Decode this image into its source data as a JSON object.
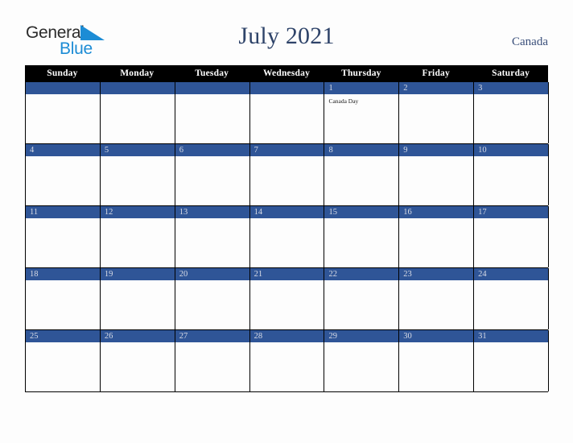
{
  "page": {
    "background_color": "#fdfdfd"
  },
  "brand": {
    "name_part1": "General",
    "name_part2": "Blue",
    "triangle_icon": "blue-triangle-logo-mark",
    "color_dark": "#2b2b2b",
    "color_blue": "#1c8cd5"
  },
  "header": {
    "title": "July 2021",
    "country": "Canada",
    "title_color": "#2e4369",
    "country_color": "#3a4f7a"
  },
  "calendar": {
    "month": "July",
    "year": "2021",
    "locale": "Canada",
    "header_bg": "#000000",
    "date_band_color": "#2f5597",
    "date_text_color": "#d9dce6",
    "cell_bg": "#fdfdfd",
    "day_names": [
      "Sunday",
      "Monday",
      "Tuesday",
      "Wednesday",
      "Thursday",
      "Friday",
      "Saturday"
    ],
    "weeks": [
      [
        {
          "date": "",
          "blank": true,
          "events": []
        },
        {
          "date": "",
          "blank": true,
          "events": []
        },
        {
          "date": "",
          "blank": true,
          "events": []
        },
        {
          "date": "",
          "blank": true,
          "events": []
        },
        {
          "date": "1",
          "blank": false,
          "events": [
            "Canada Day"
          ]
        },
        {
          "date": "2",
          "blank": false,
          "events": []
        },
        {
          "date": "3",
          "blank": false,
          "events": []
        }
      ],
      [
        {
          "date": "4",
          "blank": false,
          "events": []
        },
        {
          "date": "5",
          "blank": false,
          "events": []
        },
        {
          "date": "6",
          "blank": false,
          "events": []
        },
        {
          "date": "7",
          "blank": false,
          "events": []
        },
        {
          "date": "8",
          "blank": false,
          "events": []
        },
        {
          "date": "9",
          "blank": false,
          "events": []
        },
        {
          "date": "10",
          "blank": false,
          "events": []
        }
      ],
      [
        {
          "date": "11",
          "blank": false,
          "events": []
        },
        {
          "date": "12",
          "blank": false,
          "events": []
        },
        {
          "date": "13",
          "blank": false,
          "events": []
        },
        {
          "date": "14",
          "blank": false,
          "events": []
        },
        {
          "date": "15",
          "blank": false,
          "events": []
        },
        {
          "date": "16",
          "blank": false,
          "events": []
        },
        {
          "date": "17",
          "blank": false,
          "events": []
        }
      ],
      [
        {
          "date": "18",
          "blank": false,
          "events": []
        },
        {
          "date": "19",
          "blank": false,
          "events": []
        },
        {
          "date": "20",
          "blank": false,
          "events": []
        },
        {
          "date": "21",
          "blank": false,
          "events": []
        },
        {
          "date": "22",
          "blank": false,
          "events": []
        },
        {
          "date": "23",
          "blank": false,
          "events": []
        },
        {
          "date": "24",
          "blank": false,
          "events": []
        }
      ],
      [
        {
          "date": "25",
          "blank": false,
          "events": []
        },
        {
          "date": "26",
          "blank": false,
          "events": []
        },
        {
          "date": "27",
          "blank": false,
          "events": []
        },
        {
          "date": "28",
          "blank": false,
          "events": []
        },
        {
          "date": "29",
          "blank": false,
          "events": []
        },
        {
          "date": "30",
          "blank": false,
          "events": []
        },
        {
          "date": "31",
          "blank": false,
          "events": []
        }
      ]
    ]
  }
}
